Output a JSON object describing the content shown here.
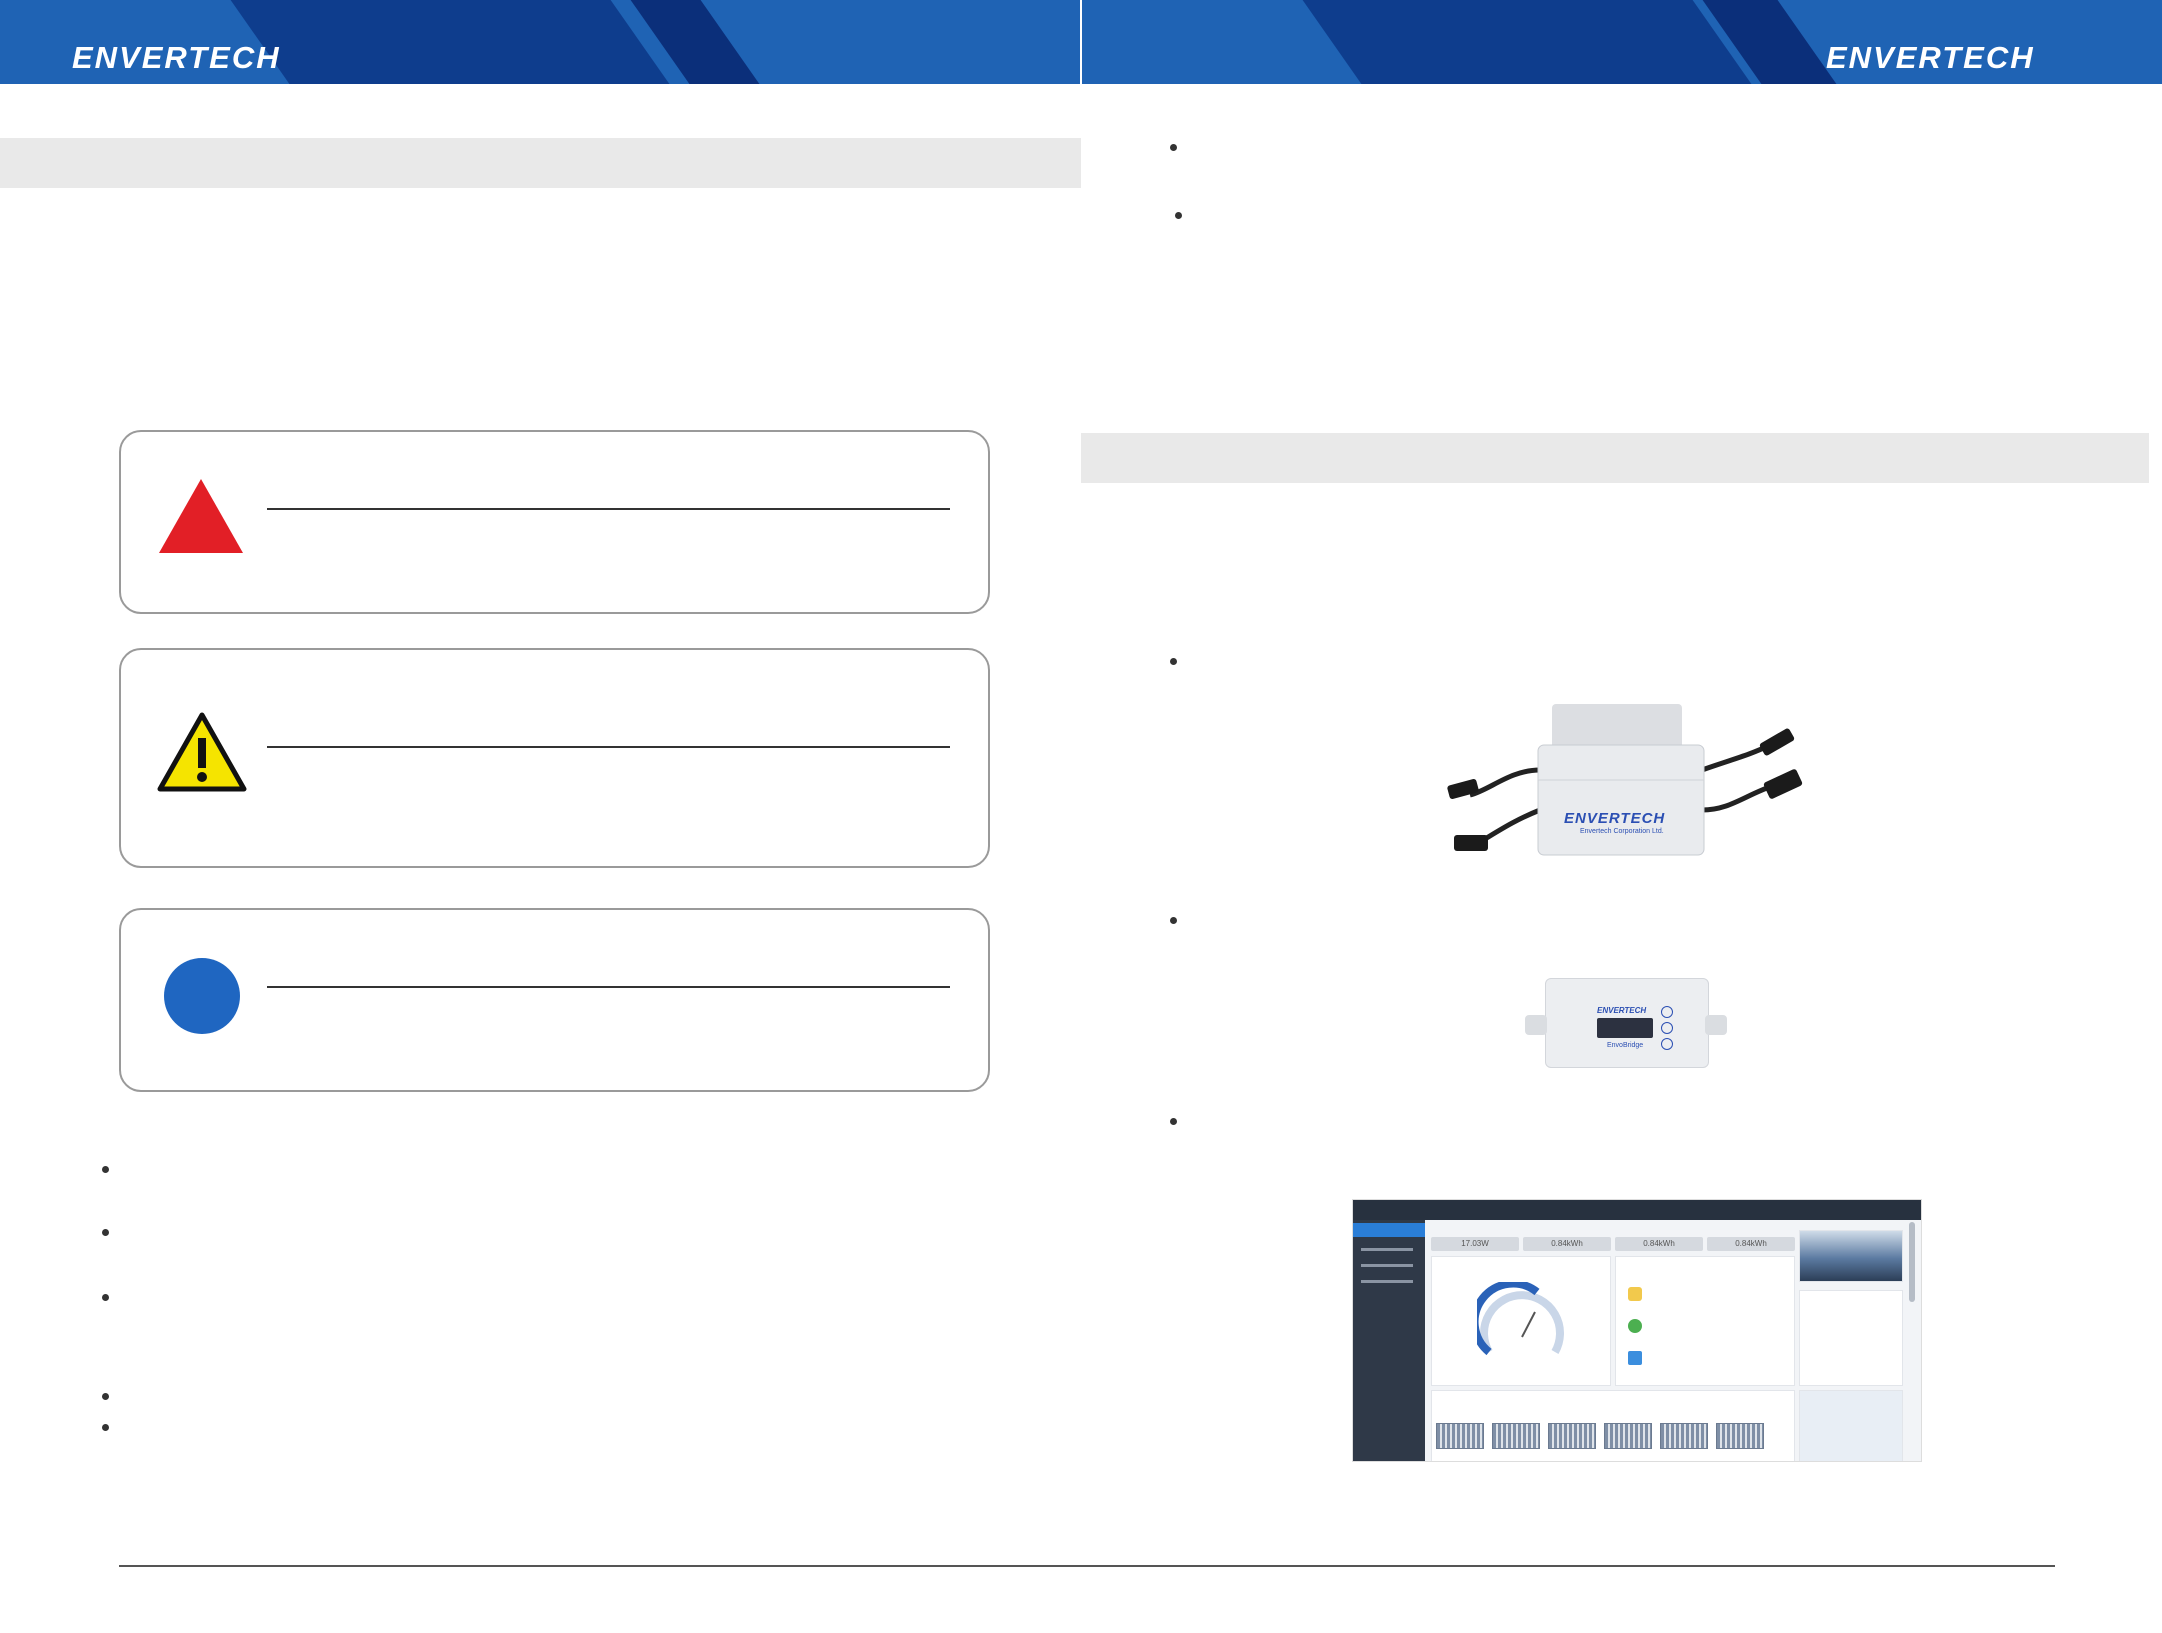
{
  "brand": {
    "logo_left": "ENVERTECH",
    "logo_right": "ENVERTECH"
  },
  "colors": {
    "header_blue": "#1f63b4",
    "header_dark": "#0d3b8f",
    "danger_red": "#e21f26",
    "warning_yellow": "#f5e400",
    "info_blue": "#1f66c1",
    "section_gray": "#e9e9e9"
  },
  "alerts": [
    {
      "icon": "danger-triangle-icon"
    },
    {
      "icon": "warning-exclamation-icon"
    },
    {
      "icon": "info-circle-icon"
    }
  ],
  "product_images": {
    "inverter_logo": "ENVERTECH",
    "inverter_subtitle": "Envertech Corporation Ltd.",
    "bridge_logo": "ENVERTECH",
    "bridge_name": "EnvoBridge"
  },
  "dashboard": {
    "kpis": [
      "17.03W",
      "0.84kWh",
      "0.84kWh",
      "0.84kWh"
    ]
  }
}
